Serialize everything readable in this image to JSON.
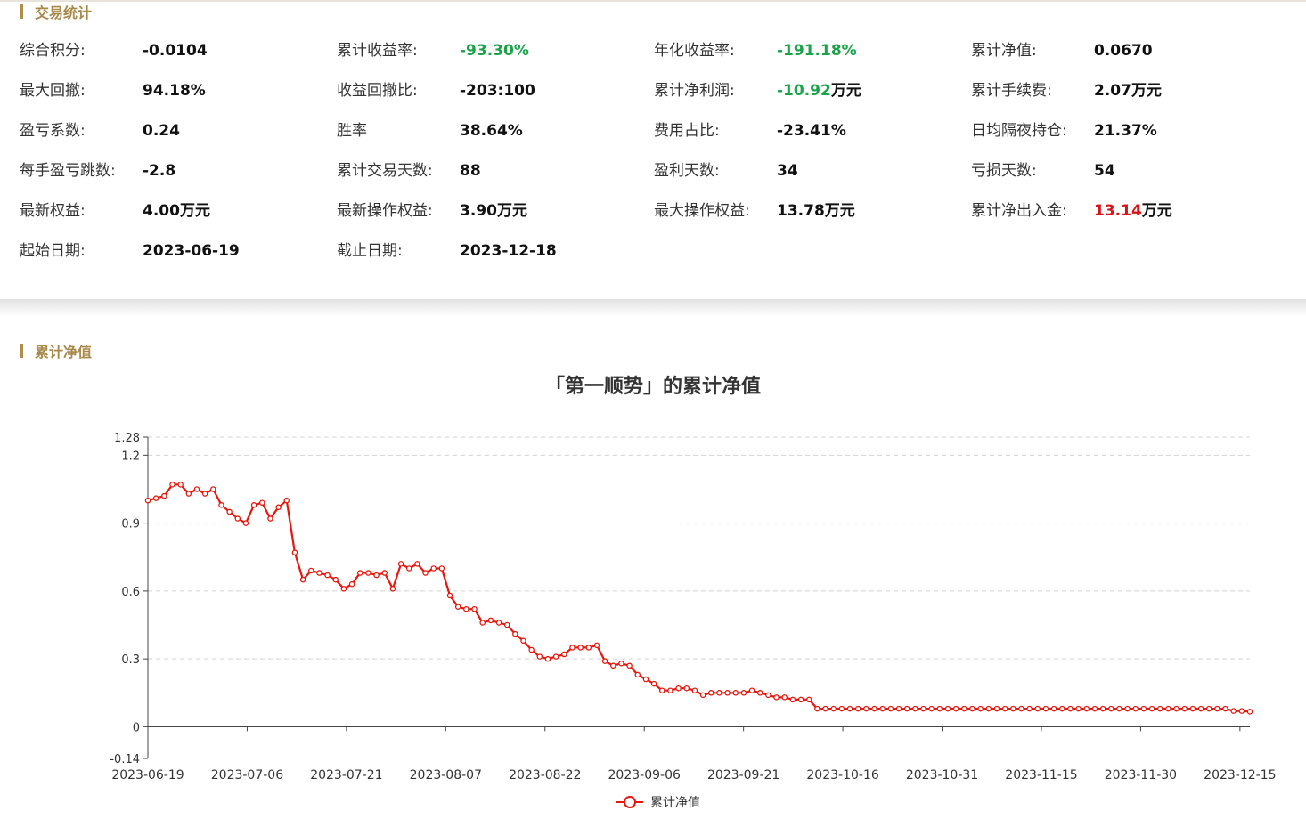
{
  "sections": {
    "stats_title": "交易统计",
    "nav_title": "累计净值"
  },
  "stats": [
    {
      "label": "综合积分:",
      "value": "-0.0104",
      "unit": "",
      "color": ""
    },
    {
      "label": "累计收益率:",
      "value": "-93.30%",
      "unit": "",
      "color": "green"
    },
    {
      "label": "年化收益率:",
      "value": "-191.18%",
      "unit": "",
      "color": "green"
    },
    {
      "label": "累计净值:",
      "value": "0.0670",
      "unit": "",
      "color": ""
    },
    {
      "label": "最大回撤:",
      "value": "94.18%",
      "unit": "",
      "color": ""
    },
    {
      "label": "收益回撤比:",
      "value": "-203:100",
      "unit": "",
      "color": ""
    },
    {
      "label": "累计净利润:",
      "value": "-10.92",
      "unit": "万元",
      "color": "green"
    },
    {
      "label": "累计手续费:",
      "value": "2.07",
      "unit": "万元",
      "color": ""
    },
    {
      "label": "盈亏系数:",
      "value": "0.24",
      "unit": "",
      "color": ""
    },
    {
      "label": "胜率",
      "value": "38.64%",
      "unit": "",
      "color": ""
    },
    {
      "label": "费用占比:",
      "value": "-23.41%",
      "unit": "",
      "color": ""
    },
    {
      "label": "日均隔夜持仓:",
      "value": "21.37%",
      "unit": "",
      "color": ""
    },
    {
      "label": "每手盈亏跳数:",
      "value": "-2.8",
      "unit": "",
      "color": ""
    },
    {
      "label": "累计交易天数:",
      "value": "88",
      "unit": "",
      "color": ""
    },
    {
      "label": "盈利天数:",
      "value": "34",
      "unit": "",
      "color": ""
    },
    {
      "label": "亏损天数:",
      "value": "54",
      "unit": "",
      "color": ""
    },
    {
      "label": "最新权益:",
      "value": "4.00",
      "unit": "万元",
      "color": ""
    },
    {
      "label": "最新操作权益:",
      "value": "3.90",
      "unit": "万元",
      "color": ""
    },
    {
      "label": "最大操作权益:",
      "value": "13.78",
      "unit": "万元",
      "color": ""
    },
    {
      "label": "累计净出入金:",
      "value": "13.14",
      "unit": "万元",
      "color": "red"
    },
    {
      "label": "起始日期:",
      "value": "2023-06-19",
      "unit": "",
      "color": ""
    },
    {
      "label": "截止日期:",
      "value": "2023-12-18",
      "unit": "",
      "color": ""
    }
  ],
  "colors": {
    "accent": "#a8894c",
    "positive": "#1aa44a",
    "negative": "#d7141c",
    "line": "#e8160c"
  },
  "chart_data": {
    "type": "line",
    "title": "「第一顺势」的累计净值",
    "ylim": [
      -0.14,
      1.28
    ],
    "yticks": [
      "-0.14",
      "0",
      "0.3",
      "0.6",
      "0.9",
      "1.2",
      "1.28"
    ],
    "ytick_values": [
      -0.14,
      0,
      0.3,
      0.6,
      0.9,
      1.2,
      1.28
    ],
    "xticks": [
      "2023-06-19",
      "2023-07-06",
      "2023-07-21",
      "2023-08-07",
      "2023-08-22",
      "2023-09-06",
      "2023-09-21",
      "2023-10-16",
      "2023-10-31",
      "2023-11-15",
      "2023-11-30",
      "2023-12-15"
    ],
    "grid": true,
    "legend": "bottom-center",
    "series": [
      {
        "name": "累计净值",
        "values": [
          1.0,
          1.01,
          1.02,
          1.07,
          1.07,
          1.03,
          1.05,
          1.03,
          1.05,
          0.98,
          0.95,
          0.92,
          0.9,
          0.98,
          0.99,
          0.92,
          0.97,
          1.0,
          0.77,
          0.65,
          0.69,
          0.68,
          0.67,
          0.65,
          0.61,
          0.63,
          0.68,
          0.68,
          0.67,
          0.68,
          0.61,
          0.72,
          0.7,
          0.72,
          0.68,
          0.7,
          0.7,
          0.58,
          0.53,
          0.52,
          0.52,
          0.46,
          0.47,
          0.46,
          0.45,
          0.41,
          0.38,
          0.34,
          0.31,
          0.3,
          0.31,
          0.32,
          0.35,
          0.35,
          0.35,
          0.36,
          0.29,
          0.27,
          0.28,
          0.27,
          0.23,
          0.21,
          0.19,
          0.16,
          0.16,
          0.17,
          0.17,
          0.16,
          0.14,
          0.15,
          0.15,
          0.15,
          0.15,
          0.15,
          0.16,
          0.15,
          0.14,
          0.13,
          0.13,
          0.12,
          0.12,
          0.12,
          0.08,
          0.08,
          0.08,
          0.08,
          0.08,
          0.08,
          0.08,
          0.08,
          0.08,
          0.08,
          0.08,
          0.08,
          0.08,
          0.08,
          0.08,
          0.08,
          0.08,
          0.08,
          0.08,
          0.08,
          0.08,
          0.08,
          0.08,
          0.08,
          0.08,
          0.08,
          0.08,
          0.08,
          0.08,
          0.08,
          0.08,
          0.08,
          0.08,
          0.08,
          0.08,
          0.08,
          0.08,
          0.08,
          0.08,
          0.08,
          0.08,
          0.08,
          0.08,
          0.08,
          0.08,
          0.08,
          0.08,
          0.08,
          0.08,
          0.08,
          0.08,
          0.07,
          0.07,
          0.067
        ]
      }
    ]
  }
}
